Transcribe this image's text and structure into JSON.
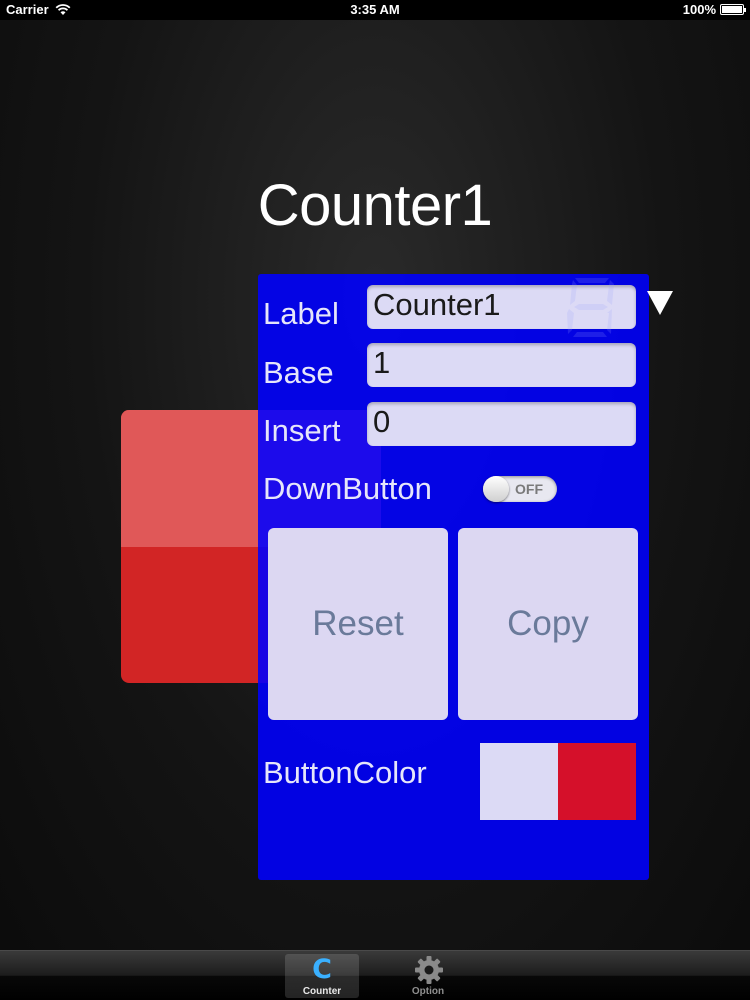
{
  "status_bar": {
    "carrier": "Carrier",
    "time": "3:35 AM",
    "battery": "100%",
    "battery_level": 1.0
  },
  "title": "Counter1",
  "counter_button": {
    "color": "#d22525",
    "highlight_color": "#e05858"
  },
  "settings": {
    "label": {
      "caption": "Label",
      "value": "Counter1"
    },
    "base": {
      "caption": "Base",
      "value": "1"
    },
    "insert": {
      "caption": "Insert",
      "value": "0"
    },
    "down_button": {
      "caption": "DownButton",
      "toggle_text": "OFF",
      "on": false
    },
    "reset_label": "Reset",
    "copy_label": "Copy",
    "button_color": {
      "caption": "ButtonColor",
      "swatches": [
        "#dcdaf5",
        "#d5102a"
      ]
    },
    "panel_color": "#0000ff"
  },
  "tab_bar": {
    "items": [
      {
        "label": "Counter",
        "icon": "counter-c-icon",
        "selected": true
      },
      {
        "label": "Option",
        "icon": "gear-icon",
        "selected": false
      }
    ]
  }
}
